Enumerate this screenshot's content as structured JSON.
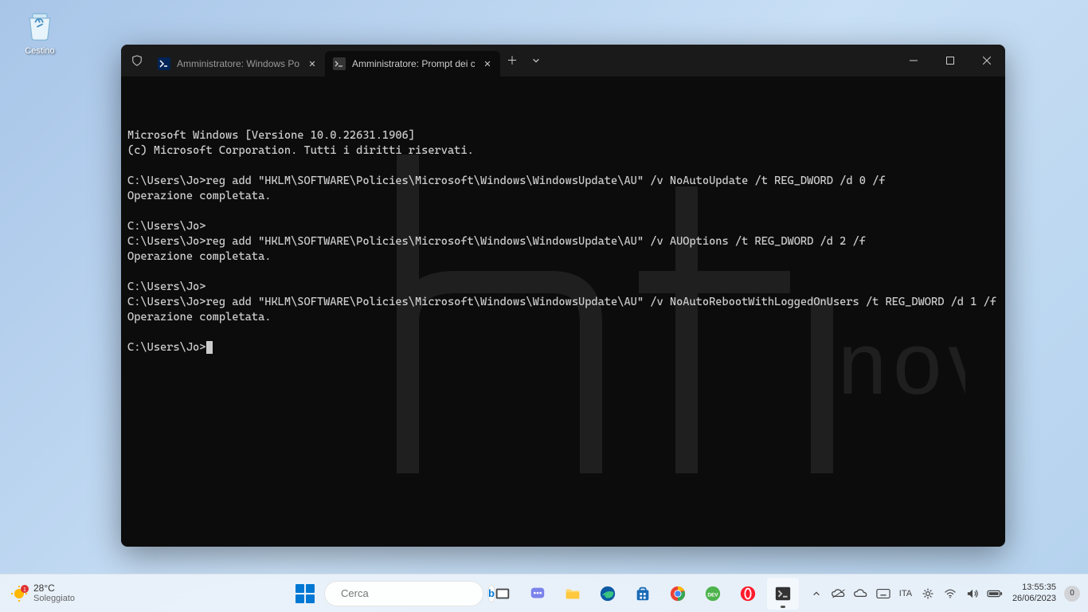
{
  "desktop": {
    "recycle_bin": "Cestino"
  },
  "terminal": {
    "tabs": [
      {
        "label": "Amministratore: Windows Pow",
        "icon": "powershell"
      },
      {
        "label": "Amministratore: Prompt dei c",
        "icon": "cmd"
      }
    ],
    "active_tab": 1,
    "lines": [
      "Microsoft Windows [Versione 10.0.22631.1906]",
      "(c) Microsoft Corporation. Tutti i diritti riservati.",
      "",
      "C:\\Users\\Jo>reg add \"HKLM\\SOFTWARE\\Policies\\Microsoft\\Windows\\WindowsUpdate\\AU\" /v NoAutoUpdate /t REG_DWORD /d 0 /f",
      "Operazione completata.",
      "",
      "C:\\Users\\Jo>",
      "C:\\Users\\Jo>reg add \"HKLM\\SOFTWARE\\Policies\\Microsoft\\Windows\\WindowsUpdate\\AU\" /v AUOptions /t REG_DWORD /d 2 /f",
      "Operazione completata.",
      "",
      "C:\\Users\\Jo>",
      "C:\\Users\\Jo>reg add \"HKLM\\SOFTWARE\\Policies\\Microsoft\\Windows\\WindowsUpdate\\AU\" /v NoAutoRebootWithLoggedOnUsers /t REG_DWORD /d 1 /f",
      "Operazione completata.",
      "",
      "C:\\Users\\Jo>"
    ],
    "watermark": "htnovo"
  },
  "taskbar": {
    "weather": {
      "temp": "28°C",
      "condition": "Soleggiato",
      "alert": "1"
    },
    "search_placeholder": "Cerca",
    "lang": "ITA",
    "time": "13:55:35",
    "date": "26/06/2023",
    "notif_count": "0"
  }
}
